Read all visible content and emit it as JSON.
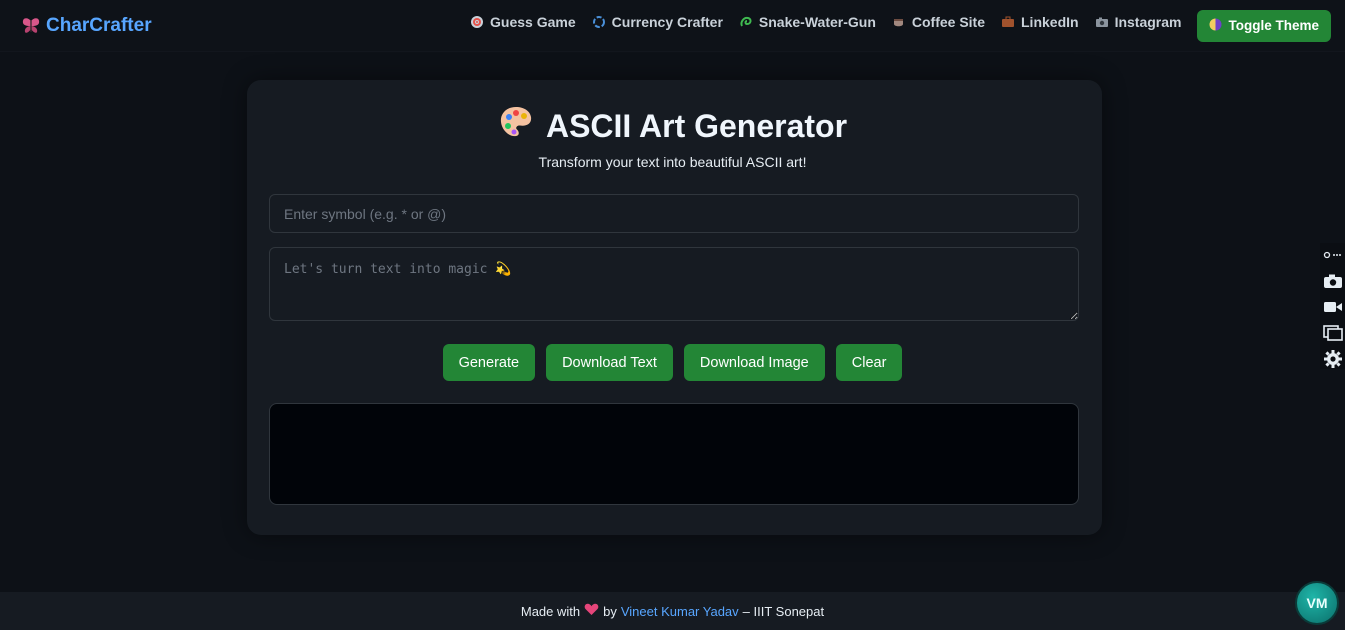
{
  "nav": {
    "brand": "CharCrafter",
    "links": [
      {
        "label": "Guess Game",
        "icon": "target-icon"
      },
      {
        "label": "Currency Crafter",
        "icon": "cycle-icon"
      },
      {
        "label": "Snake-Water-Gun",
        "icon": "snake-icon"
      },
      {
        "label": "Coffee Site",
        "icon": "coffee-icon"
      },
      {
        "label": "LinkedIn",
        "icon": "briefcase-icon"
      },
      {
        "label": "Instagram",
        "icon": "camera-icon"
      }
    ],
    "toggle_theme": "Toggle Theme"
  },
  "main": {
    "title": "ASCII Art Generator",
    "subtitle": "Transform your text into beautiful ASCII art!",
    "symbol_placeholder": "Enter symbol (e.g. * or @)",
    "text_placeholder": "Let's turn text into magic 💫",
    "buttons": {
      "generate": "Generate",
      "download_text": "Download Text",
      "download_image": "Download Image",
      "clear": "Clear"
    },
    "output": ""
  },
  "footer": {
    "made_with": "Made with",
    "by": "by",
    "author": "Vineet Kumar Yadav",
    "institute": "– IIIT Sonepat"
  },
  "avatar_initials": "VM",
  "colors": {
    "accent": "#238636",
    "link": "#58a6ff",
    "background": "#0d1117",
    "card": "#161b22"
  }
}
